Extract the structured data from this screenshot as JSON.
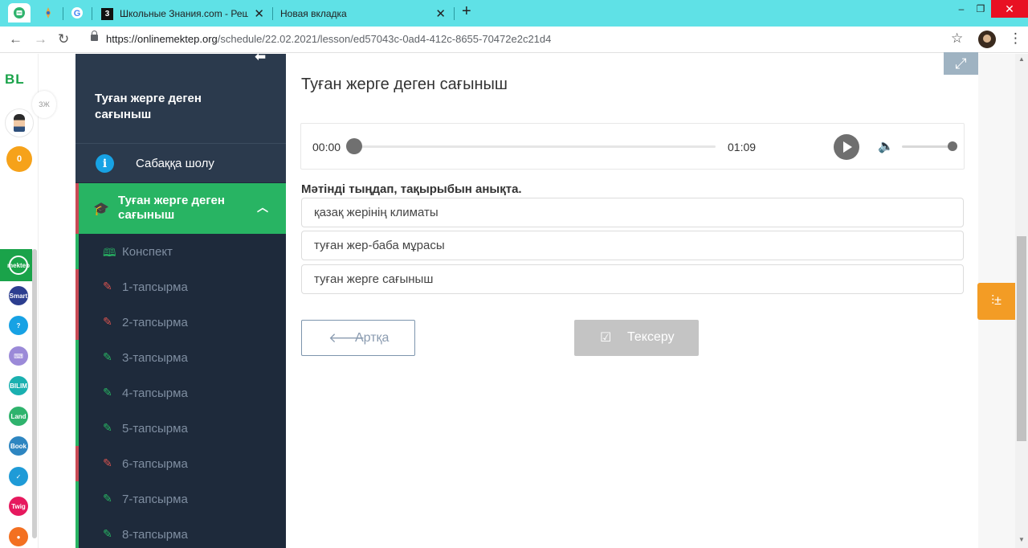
{
  "browser": {
    "tabs": [
      {
        "title": "Школьные Знания.com - Решаем"
      },
      {
        "title": "Новая вкладка"
      }
    ],
    "tab_close_glyph": "✕",
    "new_tab_glyph": "+",
    "url_host": "https://onlinemektep.org",
    "url_path": "/schedule/22.02.2021/lesson/ed57043c-0ad4-412c-8655-70472e2c21d4",
    "window_controls": {
      "minimize": "–",
      "restore": "❐",
      "close": "✕"
    }
  },
  "rail": {
    "logo": "BL",
    "coins": "0",
    "bubble_text": "ЗЖ",
    "apps": [
      {
        "name": "online-mektep",
        "text": "mektep",
        "color": "#1aa34a"
      },
      {
        "name": "smart-nation",
        "text": "Smart",
        "color": "#2c3e8f"
      },
      {
        "name": "help",
        "text": "?",
        "color": "#17a2e4"
      },
      {
        "name": "keyboard",
        "text": "⌨",
        "color": "#9b8ad8"
      },
      {
        "name": "bilim-class",
        "text": "BILIM",
        "color": "#1ab0b0"
      },
      {
        "name": "bilim-land",
        "text": "Land",
        "color": "#2fb36d"
      },
      {
        "name": "bilim-book",
        "text": "Book",
        "color": "#2e86c1"
      },
      {
        "name": "test",
        "text": "✓",
        "color": "#1f9bd7"
      },
      {
        "name": "twig",
        "text": "Twig",
        "color": "#e6195e"
      },
      {
        "name": "mektep-orange",
        "text": "●",
        "color": "#f37021"
      }
    ]
  },
  "sidebar": {
    "lesson_title": "Туған жерге деген сағыныш",
    "overview_label": "Сабаққа шолу",
    "active_label": "Туған жерге деген сағыныш",
    "items": [
      {
        "label": "Конспект",
        "icon": "book-icon",
        "status": "green"
      },
      {
        "label": "1-тапсырма",
        "icon": "edit-icon",
        "status": "red"
      },
      {
        "label": "2-тапсырма",
        "icon": "edit-icon",
        "status": "red"
      },
      {
        "label": "3-тапсырма",
        "icon": "edit-icon",
        "status": "green"
      },
      {
        "label": "4-тапсырма",
        "icon": "edit-icon",
        "status": "green"
      },
      {
        "label": "5-тапсырма",
        "icon": "edit-icon",
        "status": "green"
      },
      {
        "label": "6-тапсырма",
        "icon": "edit-icon",
        "status": "red"
      },
      {
        "label": "7-тапсырма",
        "icon": "edit-icon",
        "status": "green"
      },
      {
        "label": "8-тапсырма",
        "icon": "edit-icon",
        "status": "green"
      }
    ]
  },
  "main": {
    "title": "Туған жерге деген сағыныш",
    "audio": {
      "current": "00:00",
      "total": "01:09",
      "progress": 0,
      "volume": 1.0
    },
    "question": "Мәтінді тыңдап, тақырыбын анықта.",
    "options": [
      "қазақ жерінің климаты",
      "туған жер-баба мұрасы",
      "туған жерге сағыныш"
    ],
    "back_label": "Артқа",
    "check_label": "Тексеру"
  },
  "colors": {
    "tabbar": "#5fe1e6",
    "sidebar_bg": "#1e2a3b",
    "active_item": "#28b463",
    "float_button": "#f39c25"
  }
}
